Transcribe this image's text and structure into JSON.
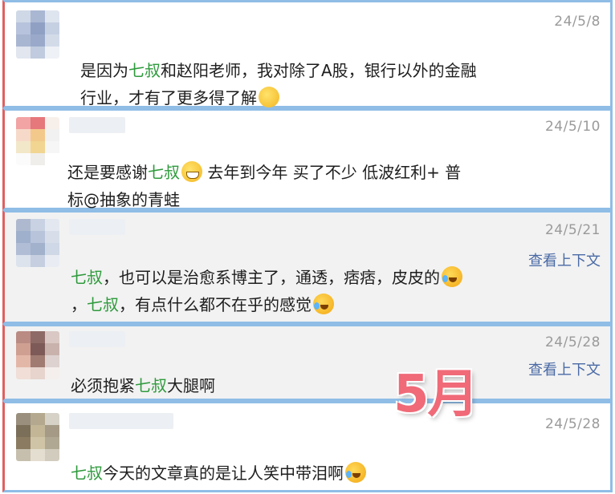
{
  "colors": {
    "highlight": "#2e9a3c",
    "link": "#4a6aa5",
    "date": "#9a9a9a",
    "badge": "#f06a78",
    "card_border": "#8fbde6"
  },
  "badge": {
    "label": "5月"
  },
  "comments": [
    {
      "date": "24/5/8",
      "text_before": "是因为",
      "highlight": "七叔",
      "text_after": "和赵阳老师，我对除了A股，银行以外的金融",
      "line2": "行业，才有了更多得了解",
      "emoji": "thinking-face-emoji"
    },
    {
      "date": "24/5/10",
      "text_before": "还是要感谢",
      "highlight": "七叔",
      "emoji": "grinning-face-emoji",
      "text_after": " 去年到今年 买了不少 低波红利+ 普",
      "line2": "标@抽象的青蛙"
    },
    {
      "date": "24/5/21",
      "context_label": "查看上下文",
      "highlight": "七叔",
      "text_after": "，也可以是治愈系博主了，通透，痞痞，皮皮的",
      "line2_prefix": "，",
      "highlight2": "七叔",
      "line2_after": "，有点什么都不在乎的感觉",
      "emoji": "rolling-laughing-emoji"
    },
    {
      "date": "24/5/28",
      "context_label": "查看上下文",
      "text_before": "必须抱紧",
      "highlight": "七叔",
      "text_after": "大腿啊"
    },
    {
      "date": "24/5/28",
      "highlight": "七叔",
      "text_after": "今天的文章真的是让人笑中带泪啊",
      "emoji": "rolling-laughing-emoji"
    }
  ]
}
